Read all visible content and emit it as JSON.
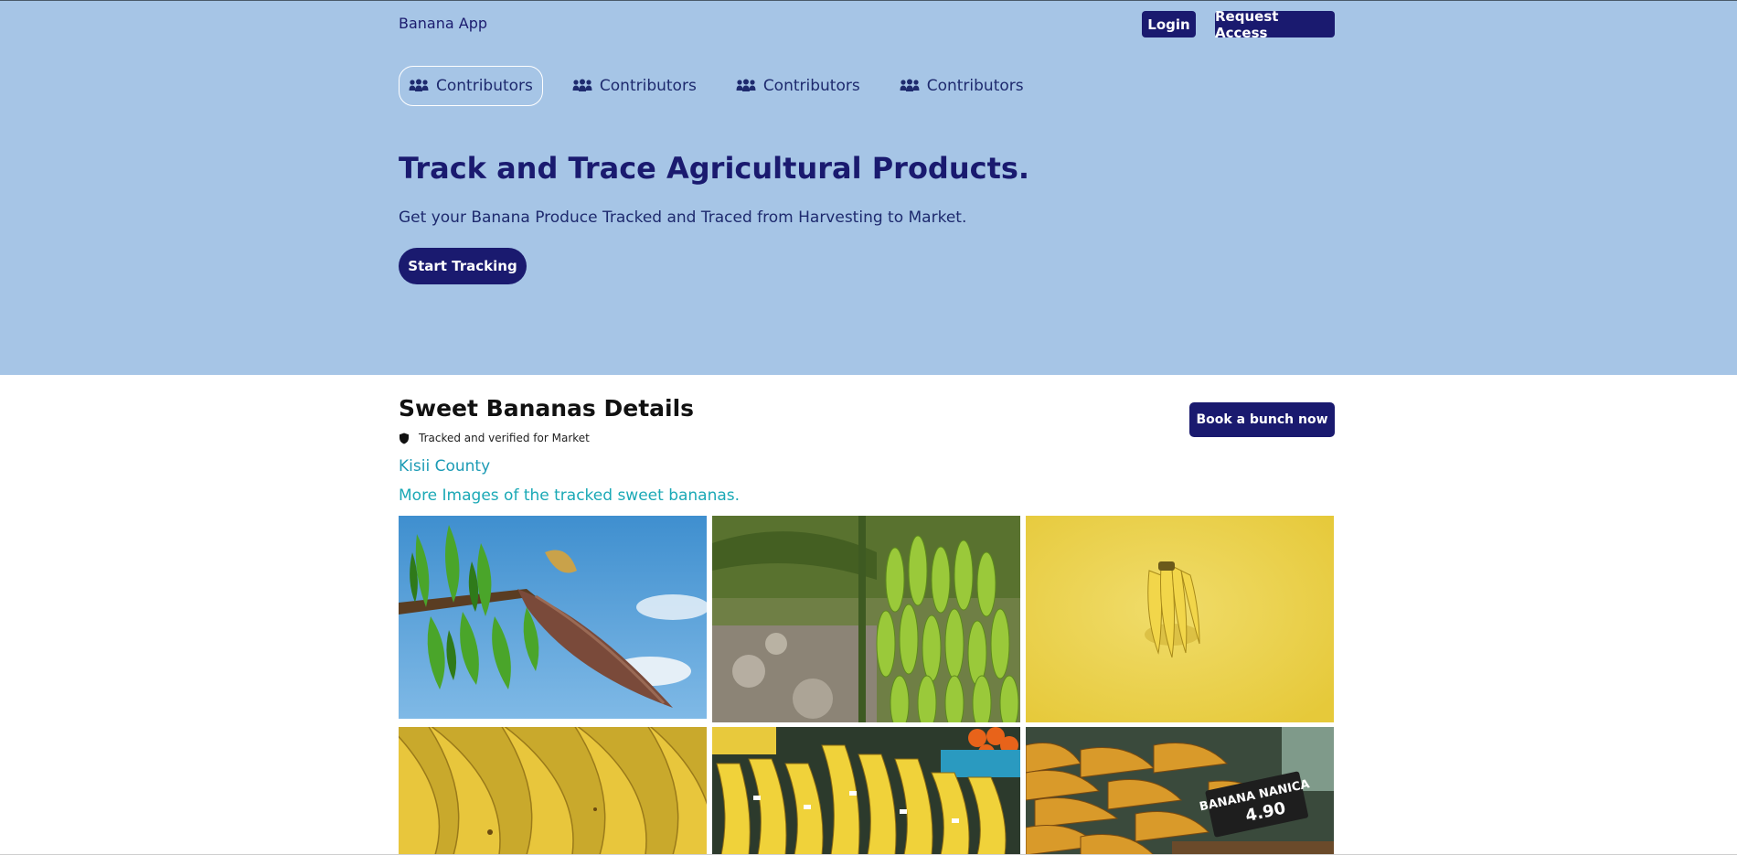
{
  "header": {
    "brand": "Banana App",
    "login_label": "Login",
    "request_access_label": "Request Access"
  },
  "nav": {
    "items": [
      {
        "label": "Contributors",
        "icon": "people-icon",
        "active": true
      },
      {
        "label": "Contributors",
        "icon": "people-icon",
        "active": false
      },
      {
        "label": "Contributors",
        "icon": "people-icon",
        "active": false
      },
      {
        "label": "Contributors",
        "icon": "people-icon",
        "active": false
      }
    ]
  },
  "hero": {
    "title": "Track and Trace Agricultural Products.",
    "subtitle": "Get your Banana Produce Tracked and Traced from Harvesting to Market.",
    "cta_label": "Start Tracking"
  },
  "details": {
    "title": "Sweet Bananas Details",
    "verified_text": "Tracked and verified for Market",
    "verified_icon": "shield-icon",
    "county": "Kisii County",
    "more_images_label": "More Images of the tracked sweet bananas.",
    "book_label": "Book a bunch now"
  },
  "gallery": {
    "images": [
      {
        "subject": "banana flower on tree against blue sky"
      },
      {
        "subject": "green banana bunch on plant"
      },
      {
        "subject": "single banana bunch on yellow background"
      },
      {
        "subject": "close-up of yellow bananas"
      },
      {
        "subject": "banana bunches at a market stall"
      },
      {
        "subject": "bananas at market with price sign"
      }
    ],
    "sign_text": "BANANA NANICA 4.90"
  },
  "colors": {
    "hero_bg": "#a6c5e6",
    "primary": "#1a1a6f",
    "link": "#1c9bb5"
  }
}
